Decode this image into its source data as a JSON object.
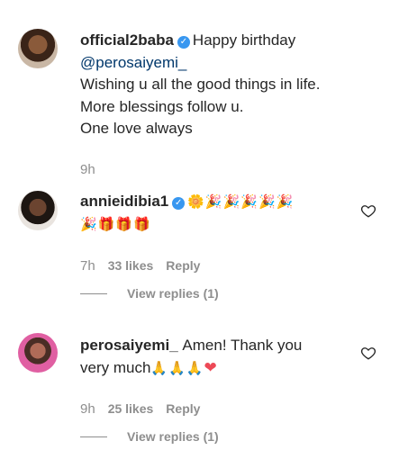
{
  "comments": [
    {
      "username": "official2baba",
      "verified": true,
      "text_part1": "Happy birthday",
      "mention": "@perosaiyemi_",
      "line3": "Wishing u all the good things in life.",
      "line4": "More blessings follow u.",
      "line5": "One love always",
      "time": "9h"
    },
    {
      "username": "annieidibia1",
      "verified": true,
      "emoji_line1": "🌼🎉🎉🎉🎉🎉",
      "emoji_line2": "🎉🎁🎁🎁",
      "time": "7h",
      "likes": "33 likes",
      "reply": "Reply",
      "view_replies": "View replies (1)"
    },
    {
      "username": "perosaiyemi_",
      "text_part1": "Amen! Thank you",
      "text_part2": "very much",
      "emojis": "🙏🙏🙏",
      "heart": "❤",
      "time": "9h",
      "likes": "25 likes",
      "reply": "Reply",
      "view_replies": "View replies (1)"
    }
  ],
  "icons": {
    "verified": "check-badge",
    "like": "heart-outline-icon"
  },
  "colors": {
    "text": "#262626",
    "secondary": "#8e8e8e",
    "verified": "#3897f0",
    "link": "#00376b"
  }
}
